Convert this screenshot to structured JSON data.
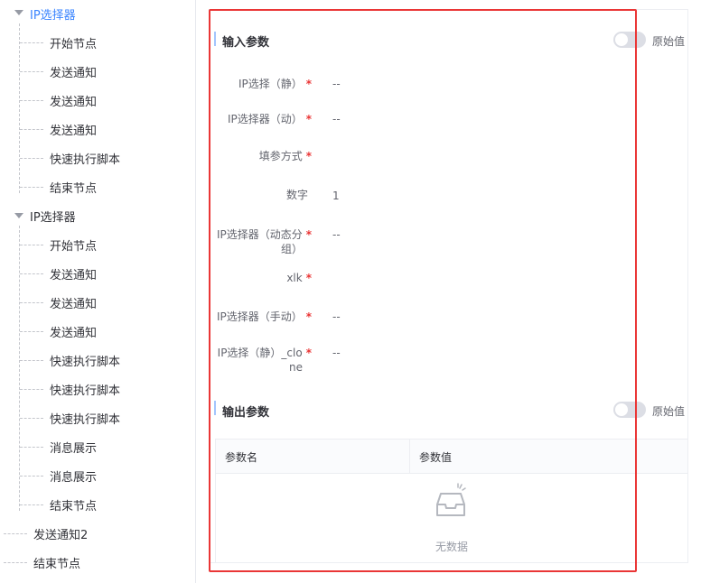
{
  "tree": {
    "group1": {
      "title": "IP选择器",
      "children": [
        "开始节点",
        "发送通知",
        "发送通知",
        "发送通知",
        "快速执行脚本",
        "结束节点"
      ]
    },
    "group2": {
      "title": "IP选择器",
      "children": [
        "开始节点",
        "发送通知",
        "发送通知",
        "发送通知",
        "快速执行脚本",
        "快速执行脚本",
        "快速执行脚本",
        "消息展示",
        "消息展示",
        "结束节点"
      ]
    },
    "bottom": [
      "发送通知2",
      "结束节点"
    ]
  },
  "inputs": {
    "title": "输入参数",
    "toggle_label": "原始值",
    "fields": [
      {
        "label": "IP选择（静）",
        "value": "--",
        "required": "*"
      },
      {
        "label": "IP选择器（动）",
        "value": "--",
        "required": "*"
      },
      {
        "label": "填参方式",
        "value": "",
        "required": "*"
      },
      {
        "label": "数字",
        "value": "1",
        "required": ""
      },
      {
        "label1": "IP选择器（动态分",
        "label2": "组）",
        "value": "--",
        "required": "*"
      },
      {
        "label": "xlk",
        "value": "",
        "required": "*"
      },
      {
        "label": "IP选择器（手动）",
        "value": "--",
        "required": "*"
      },
      {
        "label1": "IP选择（静）_clo",
        "label2": "ne",
        "value": "--",
        "required": "*"
      }
    ]
  },
  "outputs": {
    "title": "输出参数",
    "toggle_label": "原始值",
    "columns": [
      "参数名",
      "参数值"
    ],
    "empty_text": "无数据"
  },
  "colors": {
    "accent": "#3a84ff",
    "required": "#ea3636",
    "highlight_box": "#ea3636"
  }
}
